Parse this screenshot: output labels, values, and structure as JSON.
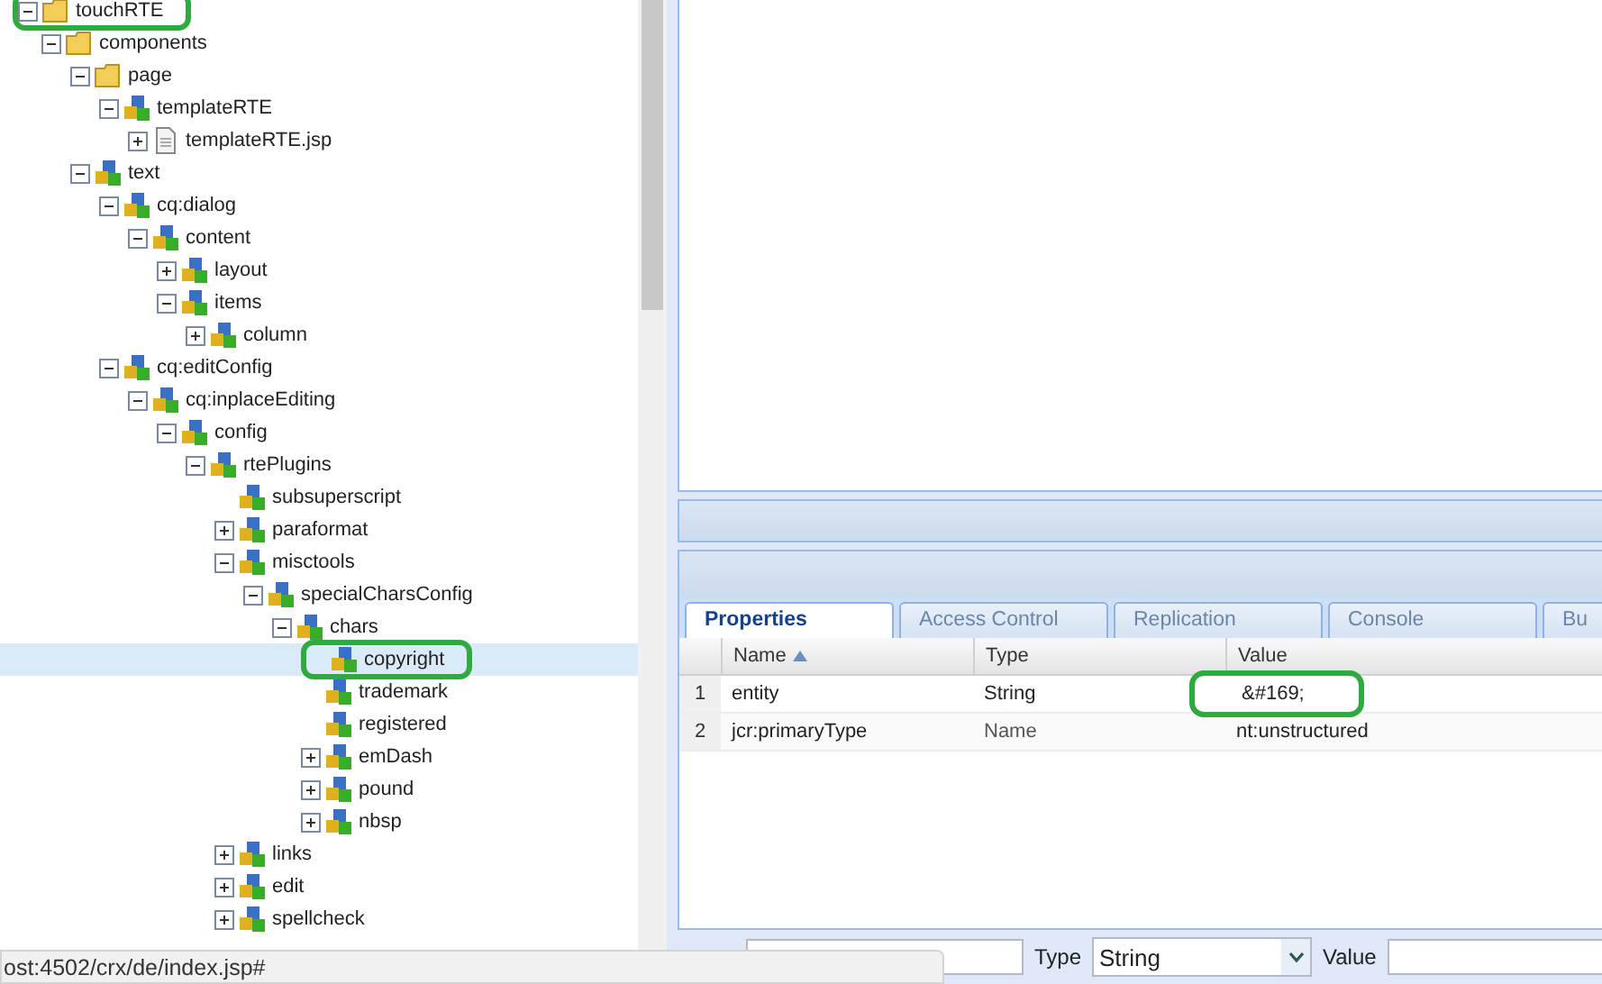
{
  "tree": [
    {
      "label": "touchRTE",
      "kind": "folder",
      "expanded": true,
      "selected": false,
      "circled": true,
      "children": [
        {
          "label": "components",
          "kind": "folder",
          "expanded": true,
          "selected": false,
          "circled": false,
          "children": [
            {
              "label": "page",
              "kind": "folder",
              "expanded": true,
              "selected": false,
              "circled": false,
              "children": [
                {
                  "label": "templateRTE",
                  "kind": "node",
                  "expanded": true,
                  "selected": false,
                  "circled": false,
                  "children": [
                    {
                      "label": "templateRTE.jsp",
                      "kind": "file",
                      "expanded": false,
                      "selected": false,
                      "circled": false
                    }
                  ]
                }
              ]
            },
            {
              "label": "text",
              "kind": "node",
              "expanded": true,
              "selected": false,
              "circled": false,
              "children": [
                {
                  "label": "cq:dialog",
                  "kind": "node",
                  "expanded": true,
                  "selected": false,
                  "circled": false,
                  "children": [
                    {
                      "label": "content",
                      "kind": "node",
                      "expanded": true,
                      "selected": false,
                      "circled": false,
                      "children": [
                        {
                          "label": "layout",
                          "kind": "node",
                          "expanded": false,
                          "selected": false,
                          "circled": false
                        },
                        {
                          "label": "items",
                          "kind": "node",
                          "expanded": true,
                          "selected": false,
                          "circled": false,
                          "children": [
                            {
                              "label": "column",
                              "kind": "node",
                              "expanded": false,
                              "selected": false,
                              "circled": false
                            }
                          ]
                        }
                      ]
                    }
                  ]
                },
                {
                  "label": "cq:editConfig",
                  "kind": "node",
                  "expanded": true,
                  "selected": false,
                  "circled": false,
                  "children": [
                    {
                      "label": "cq:inplaceEditing",
                      "kind": "node",
                      "expanded": true,
                      "selected": false,
                      "circled": false,
                      "children": [
                        {
                          "label": "config",
                          "kind": "node",
                          "expanded": true,
                          "selected": false,
                          "circled": false,
                          "children": [
                            {
                              "label": "rtePlugins",
                              "kind": "node",
                              "expanded": true,
                              "selected": false,
                              "circled": false,
                              "children": [
                                {
                                  "label": "subsuperscript",
                                  "kind": "node",
                                  "selected": false,
                                  "circled": false
                                },
                                {
                                  "label": "paraformat",
                                  "kind": "node",
                                  "expanded": false,
                                  "selected": false,
                                  "circled": false
                                },
                                {
                                  "label": "misctools",
                                  "kind": "node",
                                  "expanded": true,
                                  "selected": false,
                                  "circled": false,
                                  "children": [
                                    {
                                      "label": "specialCharsConfig",
                                      "kind": "node",
                                      "expanded": true,
                                      "selected": false,
                                      "circled": false,
                                      "children": [
                                        {
                                          "label": "chars",
                                          "kind": "node",
                                          "expanded": true,
                                          "selected": false,
                                          "circled": false,
                                          "children": [
                                            {
                                              "label": "copyright",
                                              "kind": "node",
                                              "selected": true,
                                              "circled": true
                                            },
                                            {
                                              "label": "trademark",
                                              "kind": "node",
                                              "selected": false,
                                              "circled": false
                                            },
                                            {
                                              "label": "registered",
                                              "kind": "node",
                                              "selected": false,
                                              "circled": false
                                            },
                                            {
                                              "label": "emDash",
                                              "kind": "node",
                                              "expanded": false,
                                              "selected": false,
                                              "circled": false
                                            },
                                            {
                                              "label": "pound",
                                              "kind": "node",
                                              "expanded": false,
                                              "selected": false,
                                              "circled": false
                                            },
                                            {
                                              "label": "nbsp",
                                              "kind": "node",
                                              "expanded": false,
                                              "selected": false,
                                              "circled": false
                                            }
                                          ]
                                        }
                                      ]
                                    }
                                  ]
                                },
                                {
                                  "label": "links",
                                  "kind": "node",
                                  "expanded": false,
                                  "selected": false,
                                  "circled": false
                                },
                                {
                                  "label": "edit",
                                  "kind": "node",
                                  "expanded": false,
                                  "selected": false,
                                  "circled": false
                                },
                                {
                                  "label": "spellcheck",
                                  "kind": "node",
                                  "expanded": false,
                                  "selected": false,
                                  "circled": false
                                }
                              ]
                            }
                          ]
                        }
                      ]
                    }
                  ]
                }
              ]
            }
          ]
        }
      ]
    }
  ],
  "tabs": [
    {
      "label": "Properties",
      "selected": true
    },
    {
      "label": "Access Control",
      "selected": false
    },
    {
      "label": "Replication",
      "selected": false
    },
    {
      "label": "Console",
      "selected": false
    },
    {
      "label": "Bu",
      "selected": false
    }
  ],
  "table": {
    "columns": [
      {
        "label": "Name",
        "sorted": true
      },
      {
        "label": "Type",
        "sorted": false
      },
      {
        "label": "Value",
        "sorted": false
      }
    ],
    "rows": [
      {
        "index": "1",
        "cells": [
          "entity",
          "String",
          "&#169;"
        ],
        "circled": true
      },
      {
        "index": "2",
        "cells": [
          "jcr:primaryType",
          "Name",
          "nt:unstructured"
        ],
        "circled": false
      }
    ]
  },
  "add_bar": {
    "type_label": "Type",
    "type_value": "String",
    "value_label": "Value"
  },
  "status_bar": "ost:4502/crx/de/index.jsp#"
}
